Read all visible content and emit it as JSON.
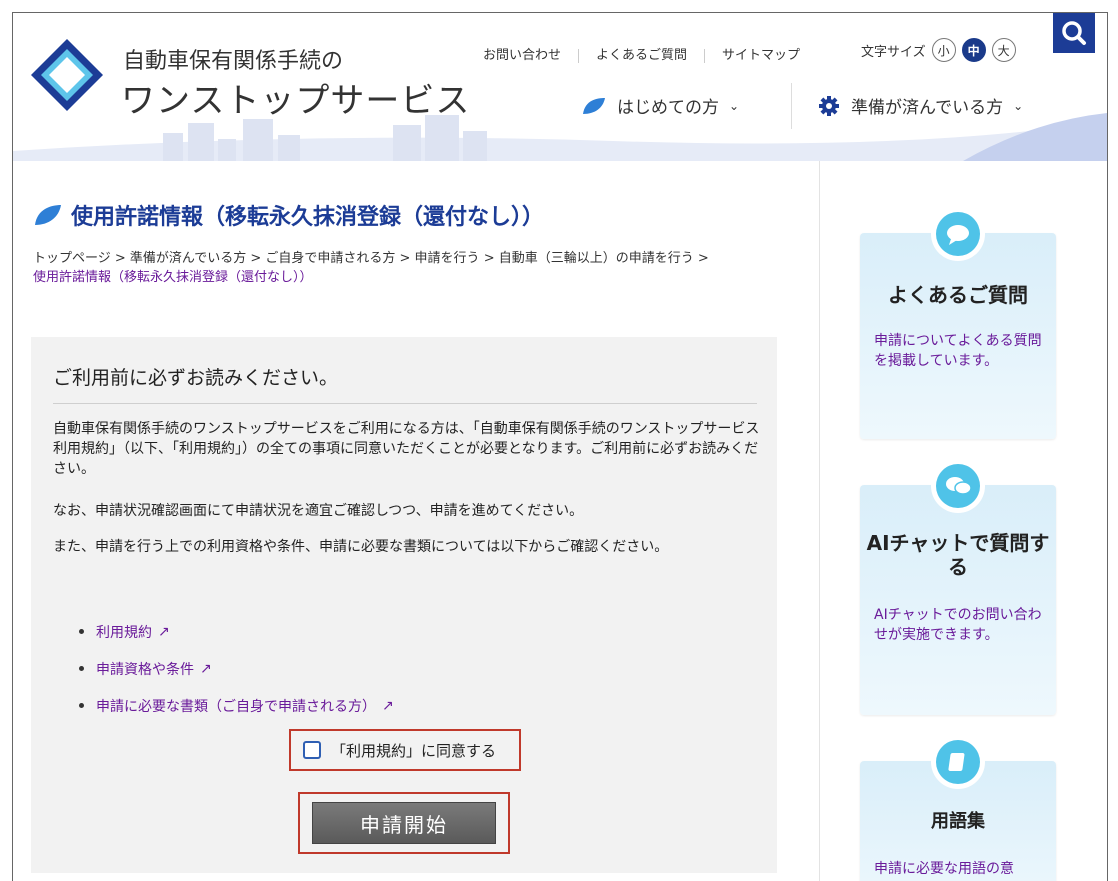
{
  "header": {
    "logo_sub": "自動車保有関係手続の",
    "logo_main": "ワンストップサービス",
    "util_links": [
      "お問い合わせ",
      "よくあるご質問",
      "サイトマップ"
    ],
    "font_size_label": "文字サイズ",
    "font_sizes": [
      "小",
      "中",
      "大"
    ],
    "nav_first_time": "はじめての方",
    "nav_prepared": "準備が済んでいる方"
  },
  "page": {
    "title": "使用許諾情報（移転永久抹消登録（還付なし））",
    "breadcrumb_line1": "トップページ > 準備が済んでいる方 > ご自身で申請される方 > 申請を行う > 自動車（三輪以上）の申請を行う >",
    "breadcrumb_current": "使用許諾情報（移転永久抹消登録（還付なし））"
  },
  "notice": {
    "heading": "ご利用前に必ずお読みください。",
    "p1": "自動車保有関係手続のワンストップサービスをご利用になる方は、「自動車保有関係手続のワンストップサービス利用規約」（以下、「利用規約」）の全ての事項に同意いただくことが必要となります。ご利用前に必ずお読みください。",
    "p2": "なお、申請状況確認画面にて申請状況を適宜ご確認しつつ、申請を進めてください。",
    "p3": "また、申請を行う上での利用資格や条件、申請に必要な書類については以下からご確認ください。",
    "links": [
      "利用規約",
      "申請資格や条件",
      "申請に必要な書類（ご自身で申請される方）"
    ],
    "agree_label": "「利用規約」に同意する",
    "start_button": "申請開始"
  },
  "sidebar": {
    "cards": [
      {
        "title": "よくあるご質問",
        "desc": "申請についてよくある質問を掲載しています。"
      },
      {
        "title": "AIチャットで質問する",
        "desc": "AIチャットでのお問い合わせが実施できます。"
      },
      {
        "title": "用語集",
        "desc": "申請に必要な用語の意"
      }
    ]
  },
  "colors": {
    "brand": "#1c3c96",
    "link": "#6a1b9a",
    "card": "#d9eef9",
    "highlight": "#c0392b",
    "icon": "#4fc3e8"
  }
}
